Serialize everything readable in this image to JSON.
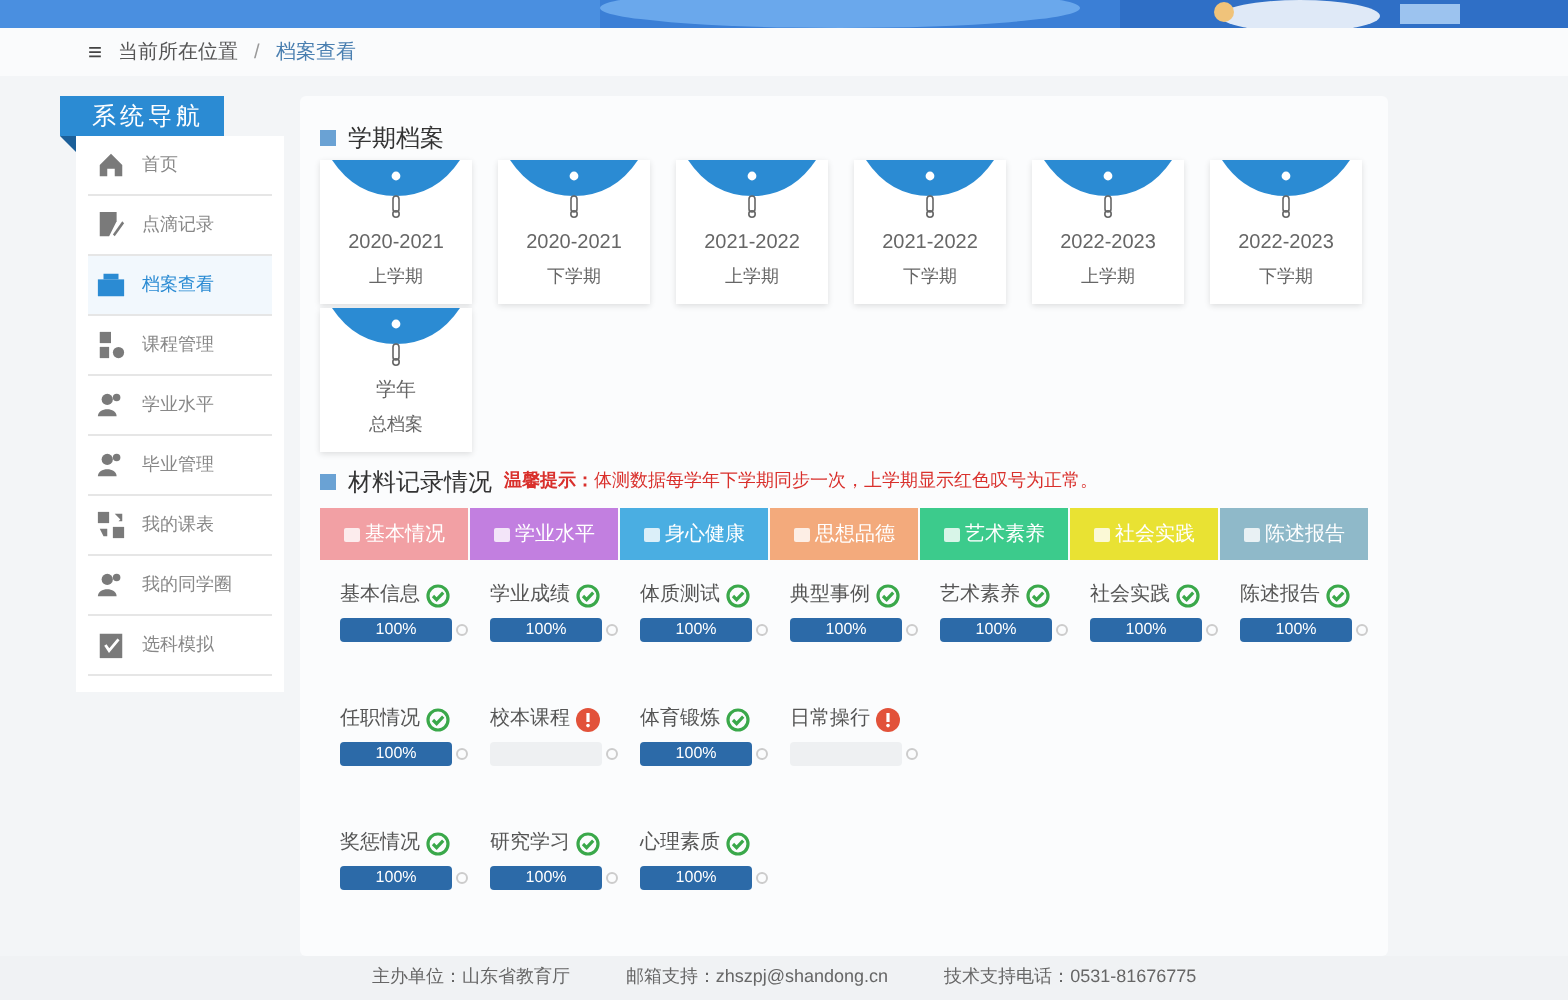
{
  "breadcrumb": {
    "menu_icon": "≡",
    "separator": "/",
    "items": [
      "当前所在位置",
      "档案查看"
    ]
  },
  "sidebar": {
    "title": "系统导航",
    "items": [
      {
        "label": "首页",
        "selected": false
      },
      {
        "label": "点滴记录",
        "selected": false
      },
      {
        "label": "档案查看",
        "selected": true
      },
      {
        "label": "课程管理",
        "selected": false
      },
      {
        "label": "学业水平",
        "selected": false
      },
      {
        "label": "毕业管理",
        "selected": false
      },
      {
        "label": "我的课表",
        "selected": false
      },
      {
        "label": "我的同学圈",
        "selected": false
      },
      {
        "label": "选科模拟",
        "selected": false
      }
    ]
  },
  "semester_section": {
    "title": "学期档案",
    "cards": [
      {
        "year": "2020-2021",
        "term": "上学期"
      },
      {
        "year": "2020-2021",
        "term": "下学期"
      },
      {
        "year": "2021-2022",
        "term": "上学期"
      },
      {
        "year": "2021-2022",
        "term": "下学期"
      },
      {
        "year": "2022-2023",
        "term": "上学期"
      },
      {
        "year": "2022-2023",
        "term": "下学期"
      },
      {
        "year": "学年",
        "term": "总档案"
      }
    ]
  },
  "materials_section": {
    "title": "材料记录情况",
    "notice_label": "温馨提示：",
    "notice": "体测数据每学年下学期同步一次，上学期显示红色叹号为正常。",
    "categories": [
      {
        "label": "基本情况",
        "color": "#f2a0a4"
      },
      {
        "label": "学业水平",
        "color": "#c27fe0"
      },
      {
        "label": "身心健康",
        "color": "#4aaee2"
      },
      {
        "label": "思想品德",
        "color": "#f3aa7c"
      },
      {
        "label": "艺术素养",
        "color": "#3ccb8c"
      },
      {
        "label": "社会实践",
        "color": "#e9e233"
      },
      {
        "label": "陈述报告",
        "color": "#8fb9c9"
      }
    ],
    "rows": [
      [
        {
          "name": "基本信息",
          "complete": true,
          "level": 1,
          "reading": "100%"
        },
        {
          "name": "学业成绩",
          "complete": true,
          "level": 1,
          "reading": "100%"
        },
        {
          "name": "体质测试",
          "complete": true,
          "level": 1,
          "reading": "100%"
        },
        {
          "name": "典型事例",
          "complete": true,
          "level": 1,
          "reading": "100%"
        },
        {
          "name": "艺术素养",
          "complete": true,
          "level": 1,
          "reading": "100%"
        },
        {
          "name": "社会实践",
          "complete": true,
          "level": 1,
          "reading": "100%"
        },
        {
          "name": "陈述报告",
          "complete": true,
          "level": 1,
          "reading": "100%"
        }
      ],
      [
        {
          "name": "任职情况",
          "complete": true,
          "level": 1,
          "reading": "100%"
        },
        {
          "name": "校本课程",
          "complete": false,
          "level": 0
        },
        {
          "name": "体育锻炼",
          "complete": true,
          "level": 1,
          "reading": "100%"
        },
        {
          "name": "日常操行",
          "complete": false,
          "level": 0
        }
      ],
      [
        {
          "name": "奖惩情况",
          "complete": true,
          "level": 1,
          "reading": "100%"
        },
        {
          "name": "研究学习",
          "complete": true,
          "level": 1,
          "reading": "100%"
        },
        {
          "name": "心理素质",
          "complete": true,
          "level": 1,
          "reading": "100%"
        }
      ]
    ]
  },
  "footer": [
    "主办单位：山东省教育厅",
    "邮箱支持：zhszpj@shandong.cn",
    "技术支持电话：0531-81676775"
  ]
}
